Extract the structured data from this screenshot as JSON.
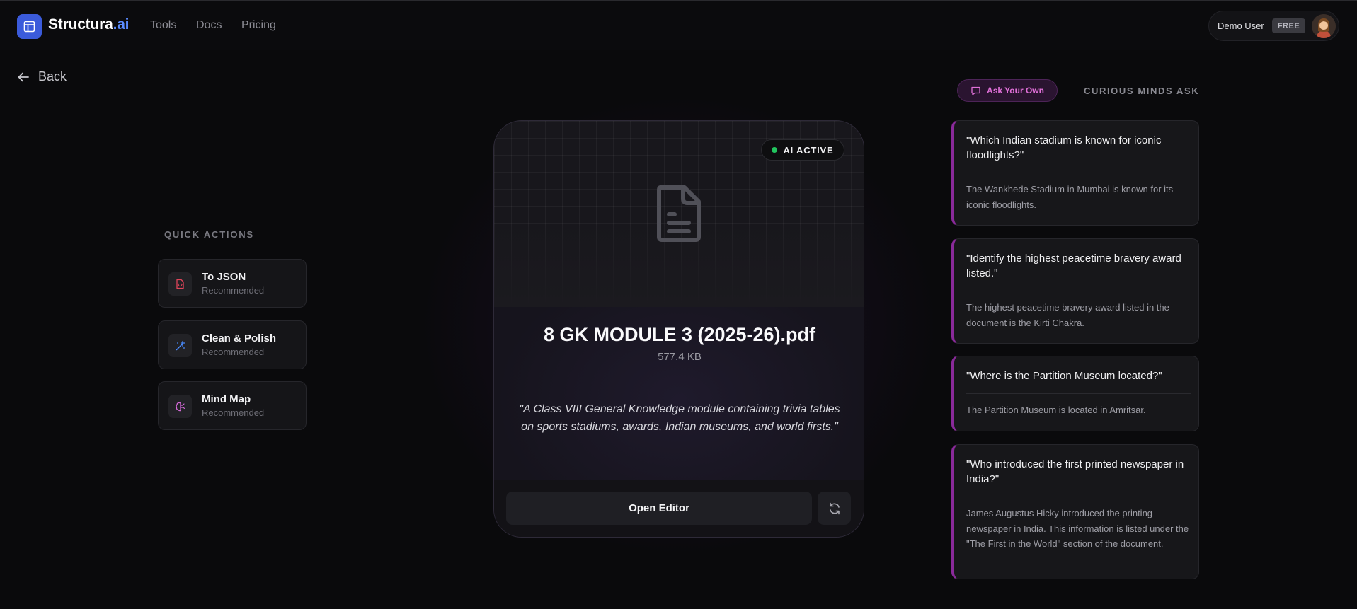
{
  "header": {
    "brand_main": "Structura",
    "brand_suffix": ".ai",
    "nav": [
      "Tools",
      "Docs",
      "Pricing"
    ],
    "user_name": "Demo User",
    "plan_badge": "FREE"
  },
  "back_label": "Back",
  "quick_actions": {
    "title": "QUICK ACTIONS",
    "items": [
      {
        "label": "To JSON",
        "sub": "Recommended",
        "icon": "json-file-icon"
      },
      {
        "label": "Clean & Polish",
        "sub": "Recommended",
        "icon": "magic-wand-icon"
      },
      {
        "label": "Mind Map",
        "sub": "Recommended",
        "icon": "brain-icon"
      }
    ]
  },
  "document": {
    "status_badge": "AI ACTIVE",
    "file_name": "8 GK MODULE 3 (2025-26).pdf",
    "file_size": "577.4 KB",
    "description": "\"A Class VIII General Knowledge module containing trivia tables on sports stadiums, awards, Indian museums, and world firsts.\"",
    "open_editor_label": "Open Editor"
  },
  "right_panel": {
    "ask_button": "Ask Your Own",
    "section_title": "CURIOUS MINDS ASK",
    "qa": [
      {
        "q": "\"Which Indian stadium is known for iconic floodlights?\"",
        "a": "The Wankhede Stadium in Mumbai is known for its iconic floodlights."
      },
      {
        "q": "\"Identify the highest peacetime bravery award listed.\"",
        "a": "The highest peacetime bravery award listed in the document is the Kirti Chakra."
      },
      {
        "q": "\"Where is the Partition Museum located?\"",
        "a": "The Partition Museum is located in Amritsar."
      },
      {
        "q": "\"Who introduced the first printed newspaper in India?\"",
        "a": "James Augustus Hicky introduced the printing newspaper in India. This information is listed under the \"The First in the World\" section of the document."
      }
    ]
  },
  "colors": {
    "accent_blue": "#3b5bdb",
    "accent_purple": "#8a2a9a",
    "status_green": "#22c55e"
  }
}
